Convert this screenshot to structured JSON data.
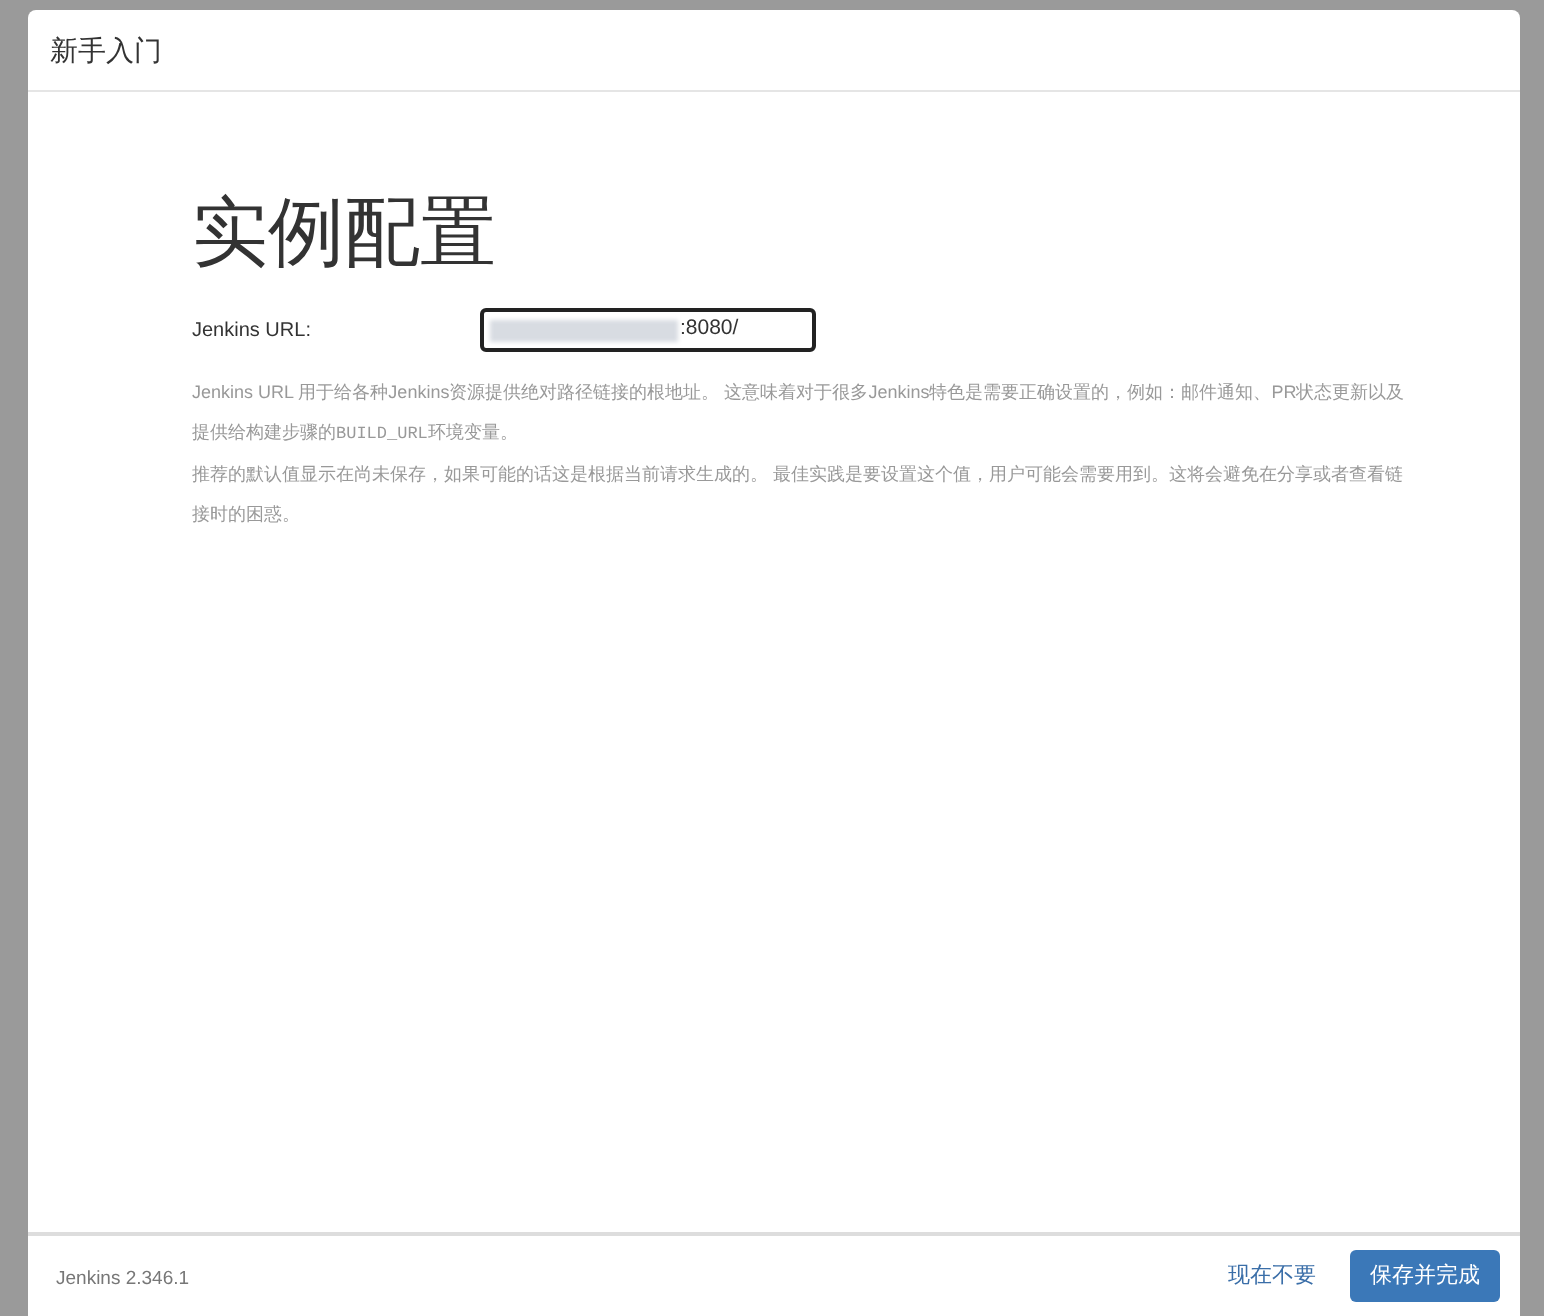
{
  "header": {
    "title": "新手入门"
  },
  "page": {
    "heading": "实例配置",
    "url_field": {
      "label": "Jenkins URL:",
      "value": ":8080/",
      "redacted": true
    },
    "help": [
      {
        "parts": [
          {
            "kind": "text",
            "text": "Jenkins URL 用于给各种Jenkins资源提供绝对路径链接的根地址。 这意味着对于很多Jenkins特色是需要正确设置的，例如：邮件通知、PR状态更新以及提供给构建步骤的"
          },
          {
            "kind": "code",
            "text": "BUILD_URL"
          },
          {
            "kind": "text",
            "text": "环境变量。"
          }
        ]
      },
      {
        "parts": [
          {
            "kind": "text",
            "text": "推荐的默认值显示在尚未保存，如果可能的话这是根据当前请求生成的。 最佳实践是要设置这个值，用户可能会需要用到。这将会避免在分享或者查看链接时的困惑。"
          }
        ]
      }
    ]
  },
  "footer": {
    "version": "Jenkins 2.346.1",
    "skip_link": "现在不要",
    "save_button": "保存并完成"
  }
}
